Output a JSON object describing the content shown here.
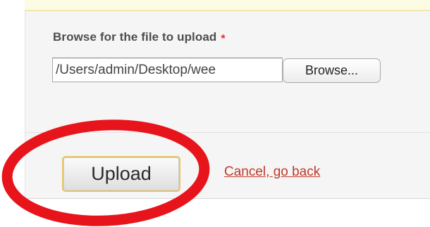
{
  "form": {
    "file_label": "Browse for the file to upload",
    "required_marker": "*",
    "file_path_value": "/Users/admin/Desktop/wee",
    "browse_label": "Browse...",
    "upload_label": "Upload",
    "cancel_label": "Cancel, go back"
  },
  "colors": {
    "required": "#e0302f",
    "cancel_link": "#c0392b",
    "annotation_ring": "#e8141c",
    "notice_background": "#fdfbe3"
  }
}
